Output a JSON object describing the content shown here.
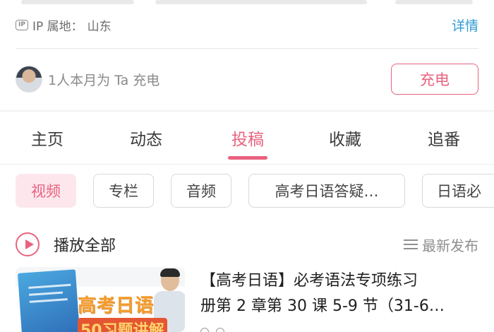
{
  "ip_location": {
    "badge": "IP",
    "label": "IP 属地：",
    "value": "山东",
    "detail_link": "详情"
  },
  "charge": {
    "text": "1人本月为 Ta 充电",
    "button": "充电"
  },
  "tabs": [
    {
      "label": "主页",
      "active": false
    },
    {
      "label": "动态",
      "active": false
    },
    {
      "label": "投稿",
      "active": true
    },
    {
      "label": "收藏",
      "active": false
    },
    {
      "label": "追番",
      "active": false
    }
  ],
  "chips": [
    {
      "label": "视频",
      "active": true
    },
    {
      "label": "专栏",
      "active": false
    },
    {
      "label": "音频",
      "active": false
    },
    {
      "label": "高考日语答疑…",
      "active": false
    },
    {
      "label": "日语必",
      "active": false
    }
  ],
  "play_all": {
    "label": "播放全部",
    "sort_label": "最新发布",
    "sort_icon": "list-icon"
  },
  "video": {
    "title_line1": "【高考日语】必考语法专项练习",
    "title_line2": "册第 2 章第 30 课 5-9 节（31-6…",
    "thumbnail": {
      "main_text": "高考日语",
      "sub_text": "50习题讲解"
    }
  },
  "colors": {
    "accent": "#e8637f",
    "link": "#2e9bd6",
    "chip_active_bg": "#fde7ec"
  }
}
